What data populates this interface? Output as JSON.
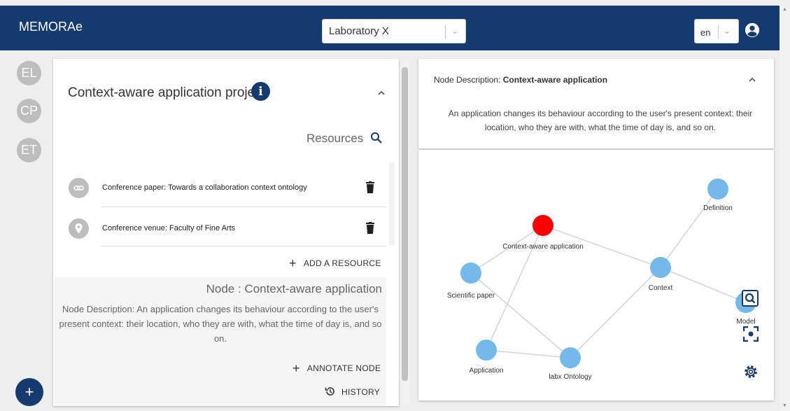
{
  "header": {
    "app_name": "MEMORAe",
    "lab_select": "Laboratory X",
    "lang_select": "en"
  },
  "sidebar": {
    "avatars": [
      "EL",
      "CP",
      "ET"
    ],
    "fab_label": "+"
  },
  "project": {
    "title": "Context-aware application project",
    "info_glyph": "i",
    "resources_label": "Resources",
    "resources": [
      {
        "icon": "link-icon",
        "text": "Conference paper: Towards a collaboration context ontology"
      },
      {
        "icon": "location-pin-icon",
        "text": "Conference venue: Faculty of Fine Arts"
      }
    ],
    "add_resource": "ADD A RESOURCE",
    "node_title": "Node : Context-aware application",
    "node_description": "Node Description: An application changes its behaviour according to the user's present context: their location, who they are with, what the time of day is, and so on.",
    "annotate": "ANNOTATE NODE",
    "history": "HISTORY"
  },
  "node_panel": {
    "label": "Node Description:",
    "name": "Context-aware application",
    "body": "An application changes its behaviour according to the user's present context: their location, who they are with, what the time of day is, and so on."
  },
  "graph": {
    "colors": {
      "node": "#74b9e8",
      "selected": "#ff0000",
      "edge": "#d6d6d6"
    },
    "nodes": [
      {
        "id": "context-aware",
        "label": "Context-aware application",
        "selected": true
      },
      {
        "id": "definition",
        "label": "Definition",
        "selected": false
      },
      {
        "id": "scientific",
        "label": "Scientific paper",
        "selected": false
      },
      {
        "id": "context",
        "label": "Context",
        "selected": false
      },
      {
        "id": "model",
        "label": "Model",
        "selected": false
      },
      {
        "id": "application",
        "label": "Application",
        "selected": false
      },
      {
        "id": "ontology",
        "label": "labx Ontology",
        "selected": false
      }
    ],
    "edges": [
      [
        "context-aware",
        "scientific"
      ],
      [
        "context-aware",
        "context"
      ],
      [
        "context-aware",
        "application"
      ],
      [
        "definition",
        "context"
      ],
      [
        "context",
        "model"
      ],
      [
        "context",
        "ontology"
      ],
      [
        "scientific",
        "ontology"
      ],
      [
        "application",
        "ontology"
      ]
    ]
  }
}
